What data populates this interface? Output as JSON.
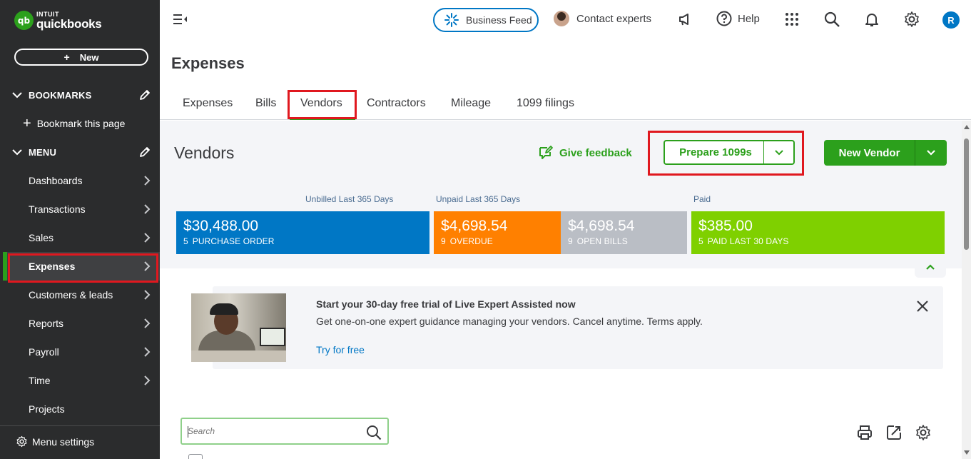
{
  "brand": {
    "intuit": "INTUIT",
    "product": "quickbooks",
    "badge": "qb"
  },
  "sidebar": {
    "new_label": "New",
    "bookmarks_label": "BOOKMARKS",
    "bookmark_this_page": "Bookmark this page",
    "menu_label": "MENU",
    "items": [
      {
        "label": "Dashboards"
      },
      {
        "label": "Transactions"
      },
      {
        "label": "Sales"
      },
      {
        "label": "Expenses"
      },
      {
        "label": "Customers & leads"
      },
      {
        "label": "Reports"
      },
      {
        "label": "Payroll"
      },
      {
        "label": "Time"
      },
      {
        "label": "Projects"
      }
    ],
    "active_item": "Expenses",
    "menu_settings": "Menu settings"
  },
  "header": {
    "business_feed": "Business Feed",
    "contact_experts": "Contact experts",
    "help": "Help",
    "user_initial": "R"
  },
  "page": {
    "title": "Expenses",
    "tabs": [
      {
        "label": "Expenses"
      },
      {
        "label": "Bills"
      },
      {
        "label": "Vendors"
      },
      {
        "label": "Contractors"
      },
      {
        "label": "Mileage"
      },
      {
        "label": "1099 filings"
      }
    ],
    "active_tab": "Vendors"
  },
  "vendors": {
    "title": "Vendors",
    "give_feedback": "Give feedback",
    "prepare_1099s": "Prepare 1099s",
    "new_vendor": "New Vendor",
    "money_bar": {
      "labels": {
        "unbilled": "Unbilled Last 365 Days",
        "unpaid": "Unpaid Last 365 Days",
        "paid": "Paid"
      },
      "boxes": [
        {
          "amount": "$30,488.00",
          "count": "5",
          "caption": "PURCHASE ORDER",
          "color": "#0077c5"
        },
        {
          "amount": "$4,698.54",
          "count": "9",
          "caption": "OVERDUE",
          "color": "#ff8000"
        },
        {
          "amount": "$4,698.54",
          "count": "9",
          "caption": "OPEN BILLS",
          "color": "#babec5"
        },
        {
          "amount": "$385.00",
          "count": "5",
          "caption": "PAID LAST 30 DAYS",
          "color": "#7fd000"
        }
      ]
    },
    "promo": {
      "title": "Start your 30-day free trial of Live Expert Assisted now",
      "description": "Get one-on-one expert guidance managing your vendors. Cancel anytime. Terms apply.",
      "link": "Try for free"
    },
    "search": {
      "placeholder": "Search",
      "value": ""
    }
  },
  "colors": {
    "brand_green": "#2ca01c",
    "link_blue": "#0077c5",
    "highlight_red": "#e0181f",
    "sidebar_bg": "#2b2c2d"
  }
}
